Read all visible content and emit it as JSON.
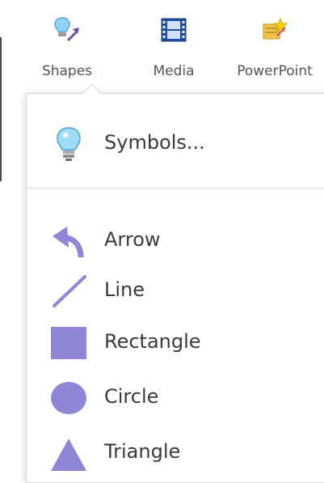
{
  "toolbar": {
    "shapes_label": "Shapes",
    "media_label": "Media",
    "powerpoint_label": "PowerPoint"
  },
  "shapes_menu": {
    "symbols_label": "Symbols...",
    "items": [
      {
        "label": "Arrow",
        "icon": "curved-arrow-icon"
      },
      {
        "label": "Line",
        "icon": "line-icon"
      },
      {
        "label": "Rectangle",
        "icon": "rectangle-icon"
      },
      {
        "label": "Circle",
        "icon": "circle-icon"
      },
      {
        "label": "Triangle",
        "icon": "triangle-icon"
      }
    ]
  },
  "colors": {
    "shape_purple": "#8f86d8",
    "label_text": "#3a3a3a"
  }
}
